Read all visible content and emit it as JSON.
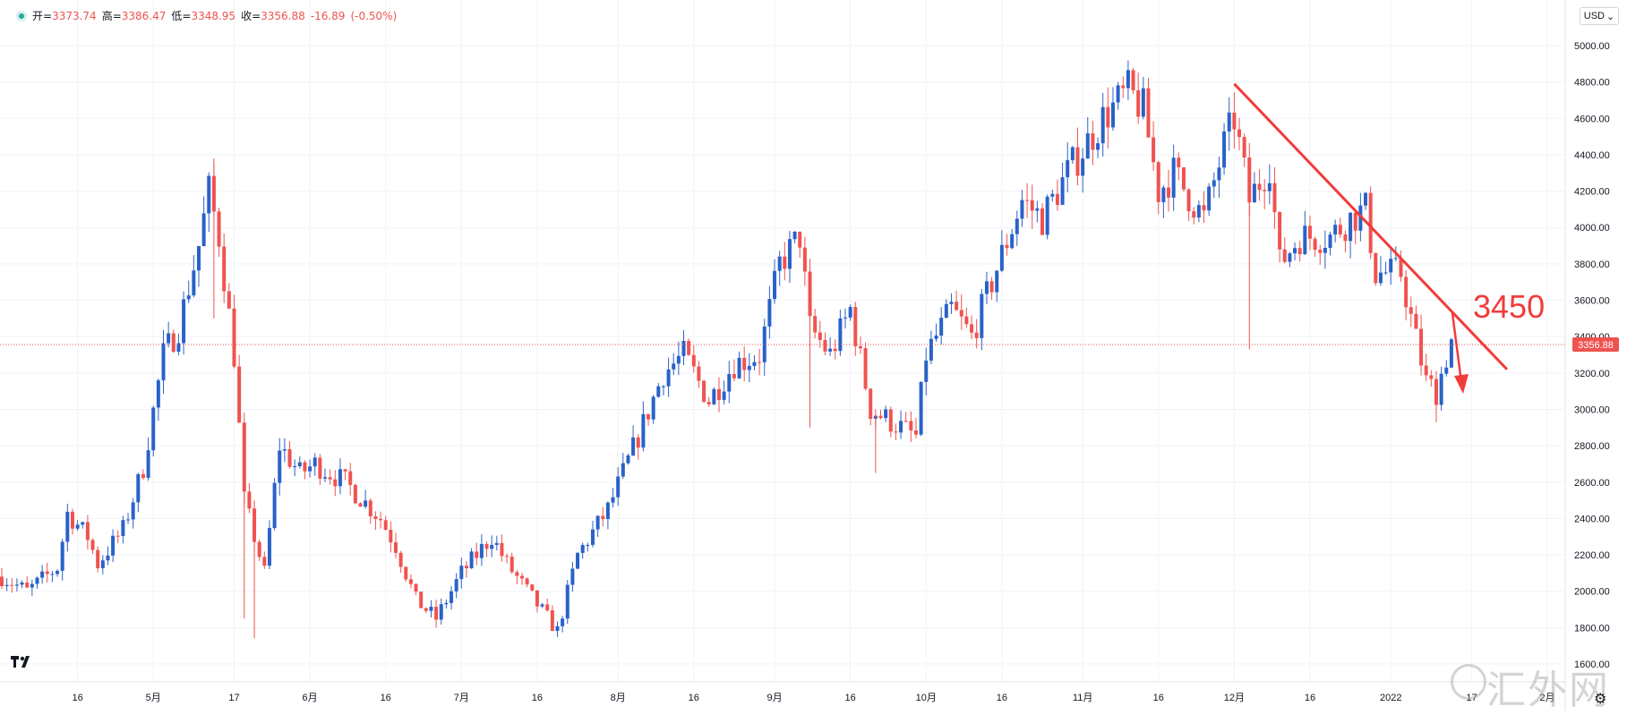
{
  "ohlc": {
    "open_label": "开=",
    "open": "3373.74",
    "high_label": "高=",
    "high": "3386.47",
    "low_label": "低=",
    "low": "3348.95",
    "close_label": "收=",
    "close": "3356.88",
    "change": "-16.89",
    "change_pct": "(-0.50%)"
  },
  "currency_button": "USD",
  "annotation_text": "3450",
  "watermark_text": "汇外网",
  "colors": {
    "up": "#2962c8",
    "down": "#ef5350",
    "annotation": "#f23b3b",
    "grid": "#f0f3fa"
  },
  "chart_data": {
    "type": "candlestick",
    "y_ticks": [
      1600,
      1800,
      2000,
      2200,
      2400,
      2600,
      2800,
      3000,
      3200,
      3400,
      3600,
      3800,
      4000,
      4200,
      4400,
      4600,
      4800,
      5000
    ],
    "y_tick_labels": [
      "1600.00",
      "1800.00",
      "2000.00",
      "2200.00",
      "2400.00",
      "2600.00",
      "2800.00",
      "3000.00",
      "3200.00",
      "3400.00",
      "3600.00",
      "3800.00",
      "4000.00",
      "4200.00",
      "4400.00",
      "4600.00",
      "4800.00",
      "5000.00"
    ],
    "ylim": [
      1470,
      5200
    ],
    "x_tick_labels": [
      "16",
      "5月",
      "17",
      "6月",
      "16",
      "7月",
      "16",
      "8月",
      "16",
      "9月",
      "16",
      "10月",
      "16",
      "11月",
      "16",
      "12月",
      "16",
      "2022",
      "17",
      "2月"
    ],
    "current_price": "3356.88",
    "trendline": {
      "from": {
        "date": "2021-12-01",
        "price": 4790
      },
      "to": {
        "date": "2022-01-24",
        "price": 3220
      }
    },
    "projection": "down",
    "close_path": [
      [
        "2021-04-01",
        2080
      ],
      [
        "2021-04-06",
        2000
      ],
      [
        "2021-04-12",
        2130
      ],
      [
        "2021-04-14",
        2430
      ],
      [
        "2021-04-18",
        2300
      ],
      [
        "2021-04-20",
        2150
      ],
      [
        "2021-04-25",
        2340
      ],
      [
        "2021-04-29",
        2680
      ],
      [
        "2021-05-03",
        3300
      ],
      [
        "2021-05-06",
        3450
      ],
      [
        "2021-05-10",
        3900
      ],
      [
        "2021-05-12",
        4200
      ],
      [
        "2021-05-14",
        3950
      ],
      [
        "2021-05-17",
        3300
      ],
      [
        "2021-05-19",
        2500
      ],
      [
        "2021-05-21",
        2300
      ],
      [
        "2021-05-23",
        2100
      ],
      [
        "2021-05-26",
        2800
      ],
      [
        "2021-05-30",
        2650
      ],
      [
        "2021-06-02",
        2700
      ],
      [
        "2021-06-08",
        2600
      ],
      [
        "2021-06-15",
        2400
      ],
      [
        "2021-06-18",
        2250
      ],
      [
        "2021-06-22",
        1950
      ],
      [
        "2021-06-26",
        1850
      ],
      [
        "2021-07-01",
        2100
      ],
      [
        "2021-07-07",
        2300
      ],
      [
        "2021-07-10",
        2150
      ],
      [
        "2021-07-14",
        2000
      ],
      [
        "2021-07-20",
        1780
      ],
      [
        "2021-07-24",
        2200
      ],
      [
        "2021-07-30",
        2450
      ],
      [
        "2021-08-05",
        2850
      ],
      [
        "2021-08-10",
        3200
      ],
      [
        "2021-08-14",
        3300
      ],
      [
        "2021-08-19",
        3050
      ],
      [
        "2021-08-24",
        3250
      ],
      [
        "2021-08-29",
        3300
      ],
      [
        "2021-09-02",
        3800
      ],
      [
        "2021-09-06",
        3950
      ],
      [
        "2021-09-08",
        3450
      ],
      [
        "2021-09-12",
        3300
      ],
      [
        "2021-09-16",
        3550
      ],
      [
        "2021-09-20",
        3000
      ],
      [
        "2021-09-23",
        2950
      ],
      [
        "2021-09-29",
        2850
      ],
      [
        "2021-10-01",
        3300
      ],
      [
        "2021-10-06",
        3550
      ],
      [
        "2021-10-10",
        3400
      ],
      [
        "2021-10-14",
        3700
      ],
      [
        "2021-10-20",
        4150
      ],
      [
        "2021-10-24",
        4050
      ],
      [
        "2021-10-29",
        4300
      ],
      [
        "2021-11-05",
        4600
      ],
      [
        "2021-11-10",
        4750
      ],
      [
        "2021-11-13",
        4650
      ],
      [
        "2021-11-16",
        4200
      ],
      [
        "2021-11-19",
        4300
      ],
      [
        "2021-11-25",
        4050
      ],
      [
        "2021-11-29",
        4450
      ],
      [
        "2021-12-01",
        4600
      ],
      [
        "2021-12-04",
        4150
      ],
      [
        "2021-12-08",
        4350
      ],
      [
        "2021-12-10",
        3800
      ],
      [
        "2021-12-14",
        3950
      ],
      [
        "2021-12-20",
        3950
      ],
      [
        "2021-12-24",
        4050
      ],
      [
        "2021-12-27",
        4100
      ],
      [
        "2021-12-29",
        3750
      ],
      [
        "2022-01-03",
        3750
      ],
      [
        "2022-01-05",
        3500
      ],
      [
        "2022-01-08",
        3150
      ],
      [
        "2022-01-10",
        3100
      ],
      [
        "2022-01-13",
        3380
      ]
    ]
  }
}
